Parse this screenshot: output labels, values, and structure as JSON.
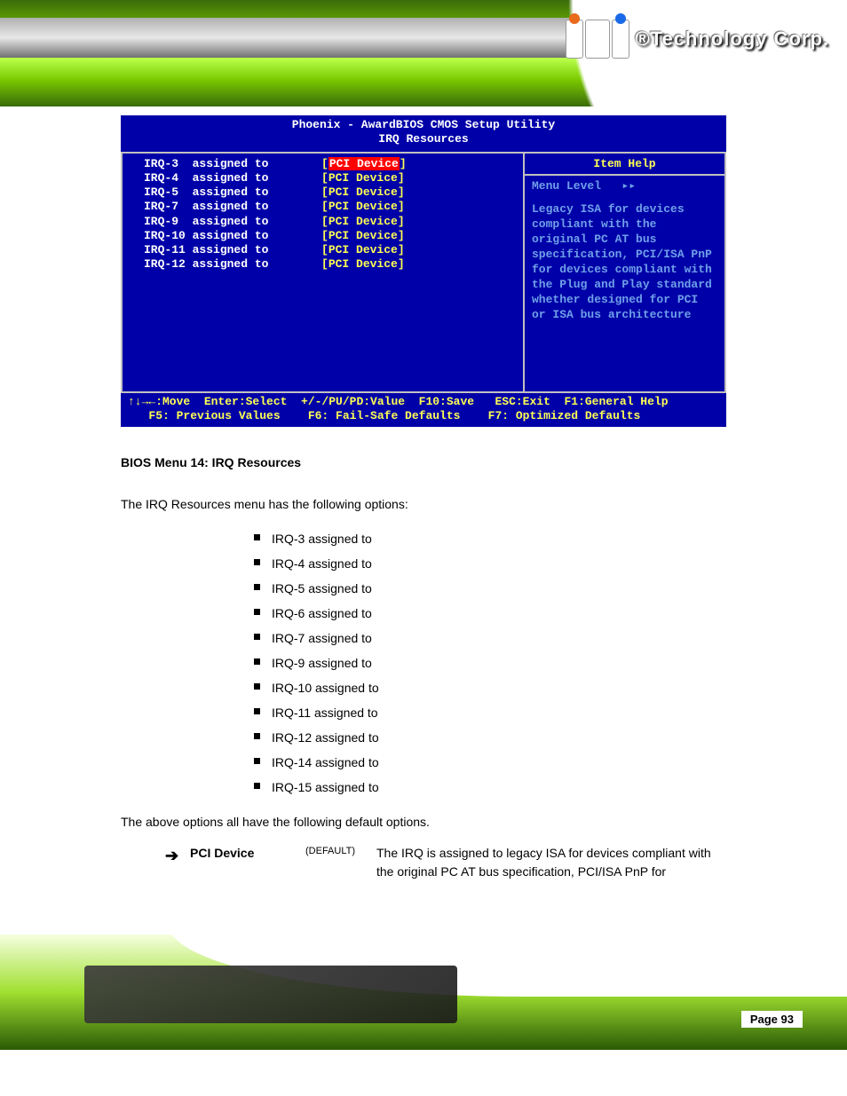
{
  "branding": {
    "company_text": "®Technology Corp."
  },
  "bios": {
    "title_line1": "Phoenix - AwardBIOS CMOS Setup Utility",
    "title_line2": "IRQ Resources",
    "irq_rows": [
      {
        "label": "IRQ-3  assigned to",
        "value": "PCI Device",
        "selected": true
      },
      {
        "label": "IRQ-4  assigned to",
        "value": "PCI Device",
        "selected": false
      },
      {
        "label": "IRQ-5  assigned to",
        "value": "PCI Device",
        "selected": false
      },
      {
        "label": "IRQ-7  assigned to",
        "value": "PCI Device",
        "selected": false
      },
      {
        "label": "IRQ-9  assigned to",
        "value": "PCI Device",
        "selected": false
      },
      {
        "label": "IRQ-10 assigned to",
        "value": "PCI Device",
        "selected": false
      },
      {
        "label": "IRQ-11 assigned to",
        "value": "PCI Device",
        "selected": false
      },
      {
        "label": "IRQ-12 assigned to",
        "value": "PCI Device",
        "selected": false
      }
    ],
    "help": {
      "title": "Item Help",
      "menu_level_label": "Menu Level",
      "menu_level_arrows": "▸▸",
      "body": "Legacy ISA for devices compliant with the original PC AT bus specification, PCI/ISA PnP for devices compliant with the Plug and Play standard whether designed for PCI or ISA bus architecture"
    },
    "footer_line1": "↑↓→←:Move  Enter:Select  +/-/PU/PD:Value  F10:Save   ESC:Exit  F1:General Help",
    "footer_line2": "   F5: Previous Values    F6: Fail-Safe Defaults    F7: Optimized Defaults"
  },
  "doc": {
    "caption": "BIOS Menu 14: IRQ Resources",
    "intro": "The IRQ Resources menu has the following options:",
    "irqs": [
      "IRQ-3 assigned to",
      "IRQ-4 assigned to",
      "IRQ-5 assigned to",
      "IRQ-6 assigned to",
      "IRQ-7 assigned to",
      "IRQ-9 assigned to",
      "IRQ-10 assigned to",
      "IRQ-11 assigned to",
      "IRQ-12 assigned to",
      "IRQ-14 assigned to",
      "IRQ-15 assigned to"
    ],
    "options_intro": "The above options all have the following default options.",
    "option": {
      "arrow": "➔",
      "label": "PCI Device",
      "flag": "(DEFAULT)",
      "desc": "The IRQ is assigned to legacy ISA for devices compliant with the original PC AT bus specification, PCI/ISA PnP for"
    }
  },
  "page_number": "Page 93"
}
